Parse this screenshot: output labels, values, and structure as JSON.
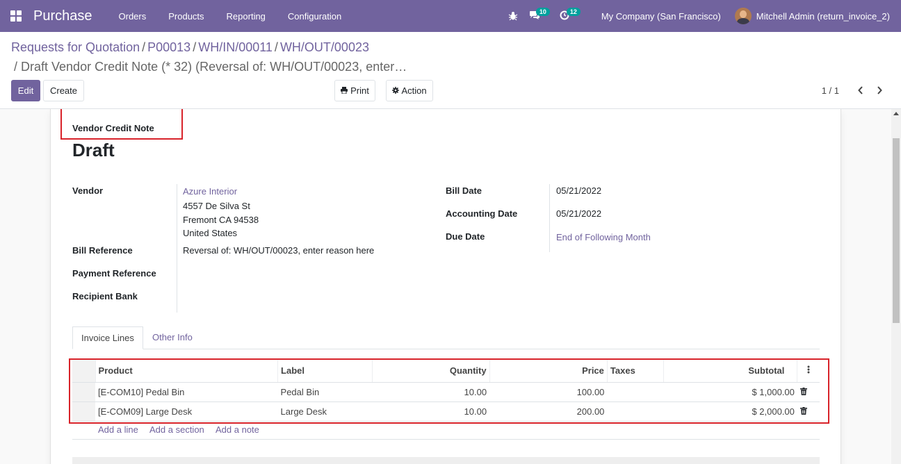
{
  "navbar": {
    "app_name": "Purchase",
    "menu": [
      "Orders",
      "Products",
      "Reporting",
      "Configuration"
    ],
    "messages_count": "10",
    "activities_count": "12",
    "company": "My Company (San Francisco)",
    "user": "Mitchell Admin (return_invoice_2)"
  },
  "breadcrumbs": {
    "items": [
      "Requests for Quotation",
      "P00013",
      "WH/IN/00011",
      "WH/OUT/00023"
    ],
    "current": "Draft Vendor Credit Note (* 32) (Reversal of: WH/OUT/00023, enter…"
  },
  "toolbar": {
    "edit_label": "Edit",
    "create_label": "Create",
    "print_label": "Print",
    "action_label": "Action",
    "pager_value": "1 / 1"
  },
  "form": {
    "type_label": "Vendor Credit Note",
    "state": "Draft",
    "vendor_label": "Vendor",
    "vendor_name": "Azure Interior",
    "vendor_street": "4557 De Silva St",
    "vendor_city": "Fremont CA 94538",
    "vendor_country": "United States",
    "bill_reference_label": "Bill Reference",
    "bill_reference_value": "Reversal of: WH/OUT/00023, enter reason here",
    "payment_reference_label": "Payment Reference",
    "recipient_bank_label": "Recipient Bank",
    "bill_date_label": "Bill Date",
    "bill_date_value": "05/21/2022",
    "accounting_date_label": "Accounting Date",
    "accounting_date_value": "05/21/2022",
    "due_date_label": "Due Date",
    "due_date_value": "End of Following Month"
  },
  "tabs": [
    "Invoice Lines",
    "Other Info"
  ],
  "invoice_lines": {
    "headers": [
      "Product",
      "Label",
      "Quantity",
      "Price",
      "Taxes",
      "Subtotal"
    ],
    "rows": [
      {
        "product": "[E-COM10] Pedal Bin",
        "label": "Pedal Bin",
        "quantity": "10.00",
        "price": "100.00",
        "taxes": "",
        "subtotal": "$ 1,000.00"
      },
      {
        "product": "[E-COM09] Large Desk",
        "label": "Large Desk",
        "quantity": "10.00",
        "price": "200.00",
        "taxes": "",
        "subtotal": "$ 2,000.00"
      }
    ],
    "add_line": "Add a line",
    "add_section": "Add a section",
    "add_note": "Add a note"
  },
  "colors": {
    "brand": "#71639e",
    "highlight": "#d8232a",
    "badge": "#00a09d"
  }
}
